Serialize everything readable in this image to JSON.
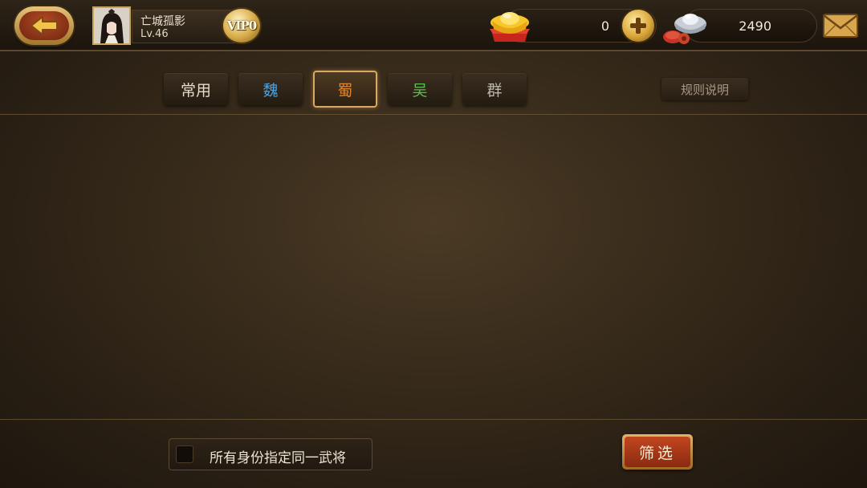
{
  "player": {
    "name": "亡城孤影",
    "level": "Lv.46",
    "vip": "VIP0"
  },
  "currency": {
    "gold": "0",
    "silver": "2490"
  },
  "tabs": [
    {
      "label": "常用",
      "color": "#e6dcc8",
      "active": false
    },
    {
      "label": "魏",
      "color": "#4aa3e0",
      "active": false
    },
    {
      "label": "蜀",
      "color": "#e0842f",
      "active": true
    },
    {
      "label": "吴",
      "color": "#5cbc4e",
      "active": false
    },
    {
      "label": "群",
      "color": "#bdb6aa",
      "active": false
    }
  ],
  "rules_label": "规则说明",
  "checkbox": {
    "label": "所有身份指定同一武将",
    "checked": false
  },
  "filter_label": "筛选",
  "colors": {
    "accent_gold": "#d9a862",
    "filter_red": "#a8381a",
    "background": "#3a2d1c"
  }
}
